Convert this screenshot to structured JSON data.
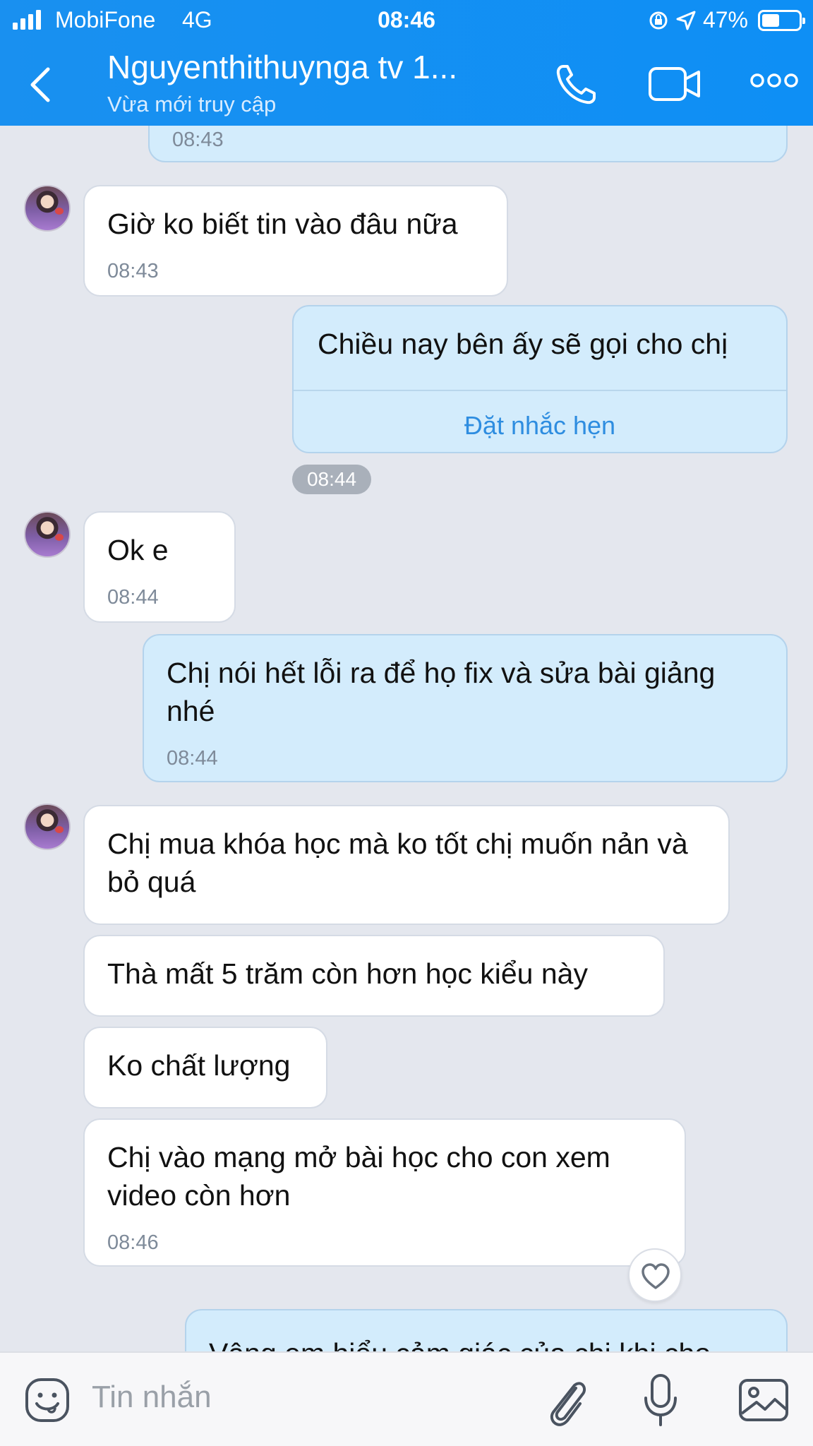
{
  "status_bar": {
    "carrier": "MobiFone",
    "network": "4G",
    "time": "08:46",
    "battery": "47%"
  },
  "header": {
    "title": "Nguyenthithuynga tv 1...",
    "subtitle": "Vừa mới truy cập",
    "icons": [
      "back-icon",
      "phone-icon",
      "video-call-icon",
      "more-icon"
    ]
  },
  "messages": [
    {
      "side": "out",
      "time": "08:43"
    },
    {
      "side": "in",
      "text": "Giờ ko biết tin vào đâu nữa",
      "time": "08:43"
    },
    {
      "side": "out",
      "text": "Chiều nay bên ấy sẽ gọi cho chị",
      "action": "Đặt nhắc hẹn",
      "time": "08:44"
    },
    {
      "side": "in",
      "text": "Ok e",
      "time": "08:44"
    },
    {
      "side": "out",
      "text": "Chị nói hết lỗi ra để họ fix và sửa bài giảng nhé",
      "time": "08:44"
    },
    {
      "side": "in",
      "text": "Chị mua khóa học mà ko tốt chị muốn nản và bỏ quá"
    },
    {
      "side": "in",
      "text": "Thà mất 5 trăm còn hơn học kiểu này"
    },
    {
      "side": "in",
      "text": "Ko chất lượng"
    },
    {
      "side": "in",
      "text": "Chị vào mạng mở bài học cho con xem video còn hơn",
      "time": "08:46"
    },
    {
      "side": "out",
      "text": "Vâng em hiểu cảm giác của chị khi cho"
    }
  ],
  "input": {
    "placeholder": "Tin nhắn",
    "icons": [
      "emoji-icon",
      "attach-icon",
      "mic-icon",
      "image-icon"
    ]
  },
  "colors": {
    "header": "#1990f0",
    "chat_bg": "#e4e7ee",
    "outgoing_bubble": "#d3ecfc",
    "incoming_bubble": "#ffffff",
    "link": "#2e8de0"
  }
}
